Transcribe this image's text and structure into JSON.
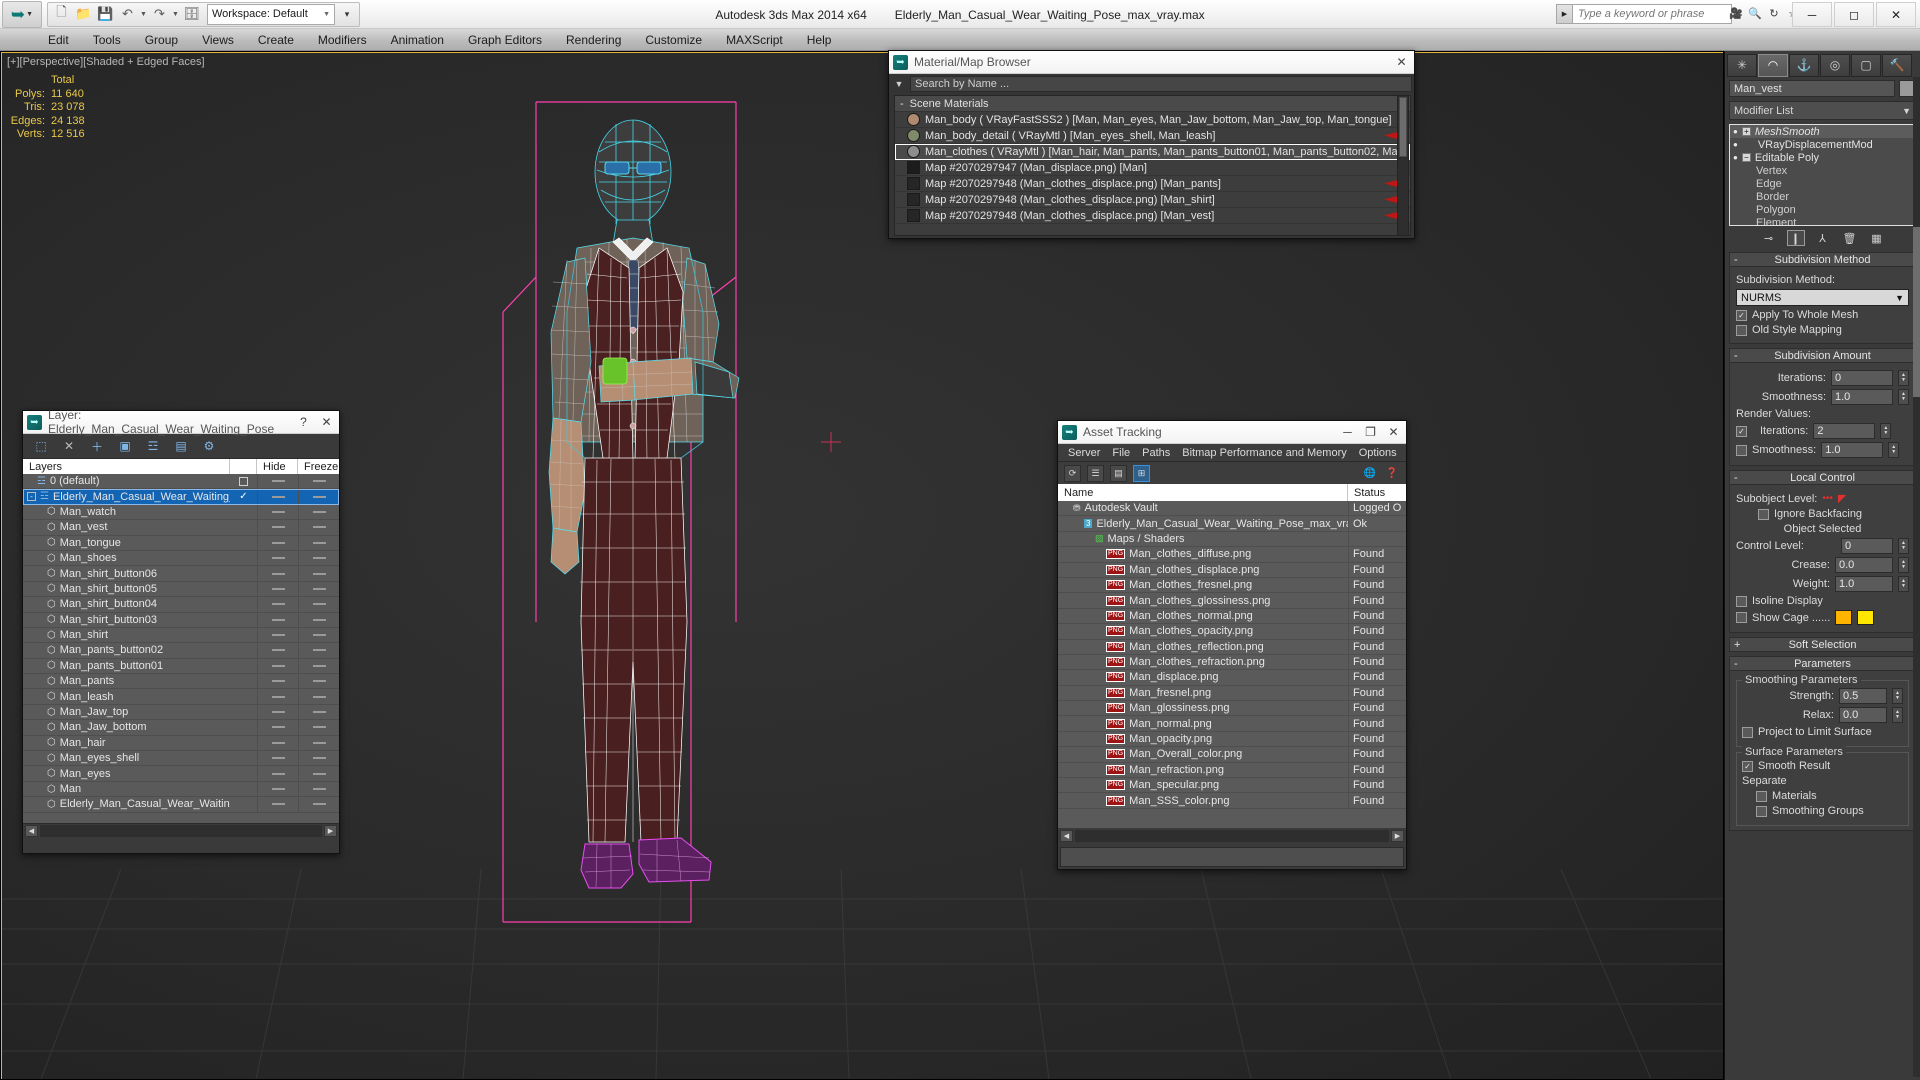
{
  "app": {
    "title": "Autodesk 3ds Max  2014 x64",
    "file_title": "Elderly_Man_Casual_Wear_Waiting_Pose_max_vray.max",
    "workspace_label": "Workspace: Default"
  },
  "quick_access": [
    {
      "name": "new-file-icon",
      "glyph": "⬜"
    },
    {
      "name": "open-file-icon",
      "glyph": "📁"
    },
    {
      "name": "save-file-icon",
      "glyph": "💾"
    },
    {
      "name": "undo-icon",
      "glyph": "↶"
    },
    {
      "name": "undo-dropdown-icon",
      "glyph": "▾"
    },
    {
      "name": "redo-icon",
      "glyph": "↷"
    },
    {
      "name": "redo-dropdown-icon",
      "glyph": "▾"
    },
    {
      "name": "set-project-folder-icon",
      "glyph": "🗂"
    }
  ],
  "menu": [
    "Edit",
    "Tools",
    "Group",
    "Views",
    "Create",
    "Modifiers",
    "Animation",
    "Graph Editors",
    "Rendering",
    "Customize",
    "MAXScript",
    "Help"
  ],
  "search": {
    "placeholder": "Type a keyword or phrase"
  },
  "titlebar_icons": [
    {
      "name": "learning-movies-icon",
      "glyph": "🎬"
    },
    {
      "name": "autodesk-search-icon",
      "glyph": "🔍"
    },
    {
      "name": "subscription-center-icon",
      "glyph": "↻"
    },
    {
      "name": "favorites-icon",
      "glyph": "☆"
    },
    {
      "name": "help-icon",
      "glyph": "?"
    }
  ],
  "window_buttons": [
    {
      "name": "minimize-button",
      "glyph": "─"
    },
    {
      "name": "maximize-button",
      "glyph": "❐"
    },
    {
      "name": "close-button",
      "glyph": "✕"
    }
  ],
  "viewport": {
    "label": "[+][Perspective][Shaded + Edged Faces]",
    "stats": {
      "header": "Total",
      "rows": [
        {
          "label": "Polys:",
          "value": "11 640"
        },
        {
          "label": "Tris:",
          "value": "23 078"
        },
        {
          "label": "Edges:",
          "value": "24 138"
        },
        {
          "label": "Verts:",
          "value": "12 516"
        }
      ]
    }
  },
  "material_browser": {
    "title": "Material/Map Browser",
    "close_label": "✕",
    "search_placeholder": "Search by Name ...",
    "group_label": "Scene Materials",
    "group_sign": "-",
    "items": [
      {
        "text": "Man_body  ( VRayFastSSS2 )  [Man, Man_eyes, Man_Jaw_bottom, Man_Jaw_top, Man_tongue]",
        "swatch": "#b08a70",
        "round": true,
        "selected": false,
        "flag": false
      },
      {
        "text": "Man_body_detail  ( VRayMtl )  [Man_eyes_shell, Man_leash]",
        "swatch": "#7f8a6a",
        "round": true,
        "selected": false,
        "flag": true
      },
      {
        "text": "Man_clothes  ( VRayMtl )  [Man_hair, Man_pants, Man_pants_button01, Man_pants_button02, Man_shirt, Man_s...",
        "swatch": "#8d8d8d",
        "round": true,
        "selected": true,
        "flag": false
      },
      {
        "text": "Map #2070297947 (Man_displace.png)  [Man]",
        "swatch": "#1c1c1c",
        "round": false,
        "selected": false,
        "flag": false
      },
      {
        "text": "Map #2070297948 (Man_clothes_displace.png)  [Man_pants]",
        "swatch": "#262626",
        "round": false,
        "selected": false,
        "flag": true
      },
      {
        "text": "Map #2070297948 (Man_clothes_displace.png)  [Man_shirt]",
        "swatch": "#262626",
        "round": false,
        "selected": false,
        "flag": true
      },
      {
        "text": "Map #2070297948 (Man_clothes_displace.png)  [Man_vest]",
        "swatch": "#262626",
        "round": false,
        "selected": false,
        "flag": true
      }
    ]
  },
  "layer_window": {
    "title": "Layer: Elderly_Man_Casual_Wear_Waiting_Pose",
    "help_label": "?",
    "close_label": "✕",
    "tools": [
      {
        "name": "create-new-layer-icon",
        "glyph": "⬚"
      },
      {
        "name": "delete-layer-icon",
        "glyph": "✕"
      },
      {
        "name": "add-selection-to-layer-icon",
        "glyph": "＋"
      },
      {
        "name": "select-objects-in-layer-icon",
        "glyph": "▣"
      },
      {
        "name": "highlight-selected-objects-icon",
        "glyph": "☲"
      },
      {
        "name": "hide-unhide-layer-icon",
        "glyph": "▤"
      },
      {
        "name": "layer-properties-icon",
        "glyph": "⚙"
      }
    ],
    "columns": [
      "Layers",
      "",
      "Hide",
      "Freeze"
    ],
    "rows": [
      {
        "name": "0 (default)",
        "indent": 1,
        "type": "layer",
        "selected": false,
        "check": false,
        "box": true
      },
      {
        "name": "Elderly_Man_Casual_Wear_Waiting_Pose",
        "indent": 0,
        "type": "layer",
        "selected": true,
        "check": true,
        "box": false,
        "expander": "-"
      },
      {
        "name": "Man_watch",
        "indent": 2,
        "type": "object",
        "selected": false
      },
      {
        "name": "Man_vest",
        "indent": 2,
        "type": "object",
        "selected": false
      },
      {
        "name": "Man_tongue",
        "indent": 2,
        "type": "object",
        "selected": false
      },
      {
        "name": "Man_shoes",
        "indent": 2,
        "type": "object",
        "selected": false
      },
      {
        "name": "Man_shirt_button06",
        "indent": 2,
        "type": "object",
        "selected": false
      },
      {
        "name": "Man_shirt_button05",
        "indent": 2,
        "type": "object",
        "selected": false
      },
      {
        "name": "Man_shirt_button04",
        "indent": 2,
        "type": "object",
        "selected": false
      },
      {
        "name": "Man_shirt_button03",
        "indent": 2,
        "type": "object",
        "selected": false
      },
      {
        "name": "Man_shirt",
        "indent": 2,
        "type": "object",
        "selected": false
      },
      {
        "name": "Man_pants_button02",
        "indent": 2,
        "type": "object",
        "selected": false
      },
      {
        "name": "Man_pants_button01",
        "indent": 2,
        "type": "object",
        "selected": false
      },
      {
        "name": "Man_pants",
        "indent": 2,
        "type": "object",
        "selected": false
      },
      {
        "name": "Man_leash",
        "indent": 2,
        "type": "object",
        "selected": false
      },
      {
        "name": "Man_Jaw_top",
        "indent": 2,
        "type": "object",
        "selected": false
      },
      {
        "name": "Man_Jaw_bottom",
        "indent": 2,
        "type": "object",
        "selected": false
      },
      {
        "name": "Man_hair",
        "indent": 2,
        "type": "object",
        "selected": false
      },
      {
        "name": "Man_eyes_shell",
        "indent": 2,
        "type": "object",
        "selected": false
      },
      {
        "name": "Man_eyes",
        "indent": 2,
        "type": "object",
        "selected": false
      },
      {
        "name": "Man",
        "indent": 2,
        "type": "object",
        "selected": false
      },
      {
        "name": "Elderly_Man_Casual_Wear_Waiting_Pose",
        "indent": 2,
        "type": "object",
        "selected": false
      }
    ]
  },
  "asset_tracking": {
    "title": "Asset Tracking",
    "minimize_label": "─",
    "maximize_label": "❐",
    "close_label": "✕",
    "menu": [
      "Server",
      "File",
      "Paths",
      "Bitmap Performance and Memory",
      "Options"
    ],
    "tools": [
      {
        "name": "refresh-icon",
        "glyph": "⟳",
        "active": false
      },
      {
        "name": "list-view-icon",
        "glyph": "☰",
        "active": false
      },
      {
        "name": "detail-view-icon",
        "glyph": "▤",
        "active": false
      },
      {
        "name": "grid-view-icon",
        "glyph": "⊞",
        "active": true
      }
    ],
    "right_tools": [
      {
        "name": "vault-help-icon",
        "glyph": "🌐"
      },
      {
        "name": "help-pointer-icon",
        "glyph": "❓"
      }
    ],
    "columns": [
      "Name",
      "Status"
    ],
    "rows": [
      {
        "name": "Autodesk Vault",
        "status": "Logged O",
        "indent": 1,
        "icon": "vault"
      },
      {
        "name": "Elderly_Man_Casual_Wear_Waiting_Pose_max_vray.max",
        "status": "Ok",
        "indent": 2,
        "icon": "max"
      },
      {
        "name": "Maps / Shaders",
        "status": "",
        "indent": 3,
        "icon": "maps"
      },
      {
        "name": "Man_clothes_diffuse.png",
        "status": "Found",
        "indent": 4,
        "icon": "png"
      },
      {
        "name": "Man_clothes_displace.png",
        "status": "Found",
        "indent": 4,
        "icon": "png"
      },
      {
        "name": "Man_clothes_fresnel.png",
        "status": "Found",
        "indent": 4,
        "icon": "png"
      },
      {
        "name": "Man_clothes_glossiness.png",
        "status": "Found",
        "indent": 4,
        "icon": "png"
      },
      {
        "name": "Man_clothes_normal.png",
        "status": "Found",
        "indent": 4,
        "icon": "png"
      },
      {
        "name": "Man_clothes_opacity.png",
        "status": "Found",
        "indent": 4,
        "icon": "png"
      },
      {
        "name": "Man_clothes_reflection.png",
        "status": "Found",
        "indent": 4,
        "icon": "png"
      },
      {
        "name": "Man_clothes_refraction.png",
        "status": "Found",
        "indent": 4,
        "icon": "png"
      },
      {
        "name": "Man_displace.png",
        "status": "Found",
        "indent": 4,
        "icon": "png"
      },
      {
        "name": "Man_fresnel.png",
        "status": "Found",
        "indent": 4,
        "icon": "png"
      },
      {
        "name": "Man_glossiness.png",
        "status": "Found",
        "indent": 4,
        "icon": "png"
      },
      {
        "name": "Man_normal.png",
        "status": "Found",
        "indent": 4,
        "icon": "png"
      },
      {
        "name": "Man_opacity.png",
        "status": "Found",
        "indent": 4,
        "icon": "png"
      },
      {
        "name": "Man_Overall_color.png",
        "status": "Found",
        "indent": 4,
        "icon": "png"
      },
      {
        "name": "Man_refraction.png",
        "status": "Found",
        "indent": 4,
        "icon": "png"
      },
      {
        "name": "Man_specular.png",
        "status": "Found",
        "indent": 4,
        "icon": "png"
      },
      {
        "name": "Man_SSS_color.png",
        "status": "Found",
        "indent": 4,
        "icon": "png"
      }
    ]
  },
  "command_panel": {
    "tabs": [
      {
        "name": "create-tab",
        "glyph": "✳",
        "active": false
      },
      {
        "name": "modify-tab",
        "glyph": "◠",
        "active": true
      },
      {
        "name": "hierarchy-tab",
        "glyph": "⚓",
        "active": false
      },
      {
        "name": "motion-tab",
        "glyph": "◎",
        "active": false
      },
      {
        "name": "display-tab",
        "glyph": "▢",
        "active": false
      },
      {
        "name": "utilities-tab",
        "glyph": "🔨",
        "active": false
      }
    ],
    "object_name": "Man_vest",
    "modifier_list_label": "Modifier List",
    "modifier_stack": [
      {
        "label": "MeshSmooth",
        "italic": true,
        "plus": true,
        "selected": true,
        "indent": 0
      },
      {
        "label": "VRayDisplacementMod",
        "italic": false,
        "plus": false,
        "selected": false,
        "indent": 1
      },
      {
        "label": "Editable Poly",
        "italic": false,
        "minus": true,
        "selected": false,
        "indent": 0
      },
      {
        "label": "Vertex",
        "sub": true
      },
      {
        "label": "Edge",
        "sub": true
      },
      {
        "label": "Border",
        "sub": true
      },
      {
        "label": "Polygon",
        "sub": true
      },
      {
        "label": "Element",
        "sub": true
      }
    ],
    "stack_tools": [
      {
        "name": "pin-stack-icon",
        "glyph": "⊸"
      },
      {
        "name": "show-end-result-icon",
        "glyph": "❙",
        "framed": true
      },
      {
        "name": "make-unique-icon",
        "glyph": "⅄"
      },
      {
        "name": "remove-modifier-icon",
        "glyph": "🗑"
      },
      {
        "name": "configure-modifier-sets-icon",
        "glyph": "▦"
      }
    ],
    "rollouts": [
      {
        "name": "subdivision-method",
        "title": "Subdivision Method",
        "sign": "-",
        "field_label": "Subdivision Method:",
        "select_value": "NURMS",
        "checkboxes": [
          {
            "label": "Apply To Whole Mesh",
            "checked": true
          },
          {
            "label": "Old Style Mapping",
            "checked": false
          }
        ]
      },
      {
        "name": "subdivision-amount",
        "title": "Subdivision Amount",
        "sign": "-",
        "iterations_label": "Iterations:",
        "iterations_value": "0",
        "smoothness_label": "Smoothness:",
        "smoothness_value": "1.0",
        "render_values_label": "Render Values:",
        "render_iterations_label": "Iterations:",
        "render_iterations_value": "2",
        "render_iterations_checked": true,
        "render_smoothness_label": "Smoothness:",
        "render_smoothness_value": "1.0",
        "render_smoothness_checked": false
      },
      {
        "name": "local-control",
        "title": "Local Control",
        "sign": "-",
        "subobject_label": "Subobject Level:",
        "ignore_backfacing_label": "Ignore Backfacing",
        "ignore_backfacing_checked": false,
        "object_selected_label": "Object Selected",
        "control_level_label": "Control Level:",
        "control_level_value": "0",
        "crease_label": "Crease:",
        "crease_value": "0.0",
        "weight_label": "Weight:",
        "weight_value": "1.0",
        "isoline_label": "Isoline Display",
        "isoline_checked": false,
        "showcage_label": "Show Cage ......",
        "showcage_checked": false,
        "cage_color_1": "#ffb400",
        "cage_color_2": "#ffe600"
      },
      {
        "name": "soft-selection",
        "title": "Soft Selection",
        "sign": "+"
      },
      {
        "name": "parameters",
        "title": "Parameters",
        "sign": "-",
        "group_smoothing": "Smoothing Parameters",
        "strength_label": "Strength:",
        "strength_value": "0.5",
        "relax_label": "Relax:",
        "relax_value": "0.0",
        "project_label": "Project to Limit Surface",
        "project_checked": false,
        "group_surface": "Surface Parameters",
        "smooth_result_label": "Smooth Result",
        "smooth_result_checked": true,
        "separate_label": "Separate",
        "materials_label": "Materials",
        "materials_checked": false,
        "smoothing_groups_label": "Smoothing Groups",
        "smoothing_groups_checked": false
      }
    ]
  }
}
